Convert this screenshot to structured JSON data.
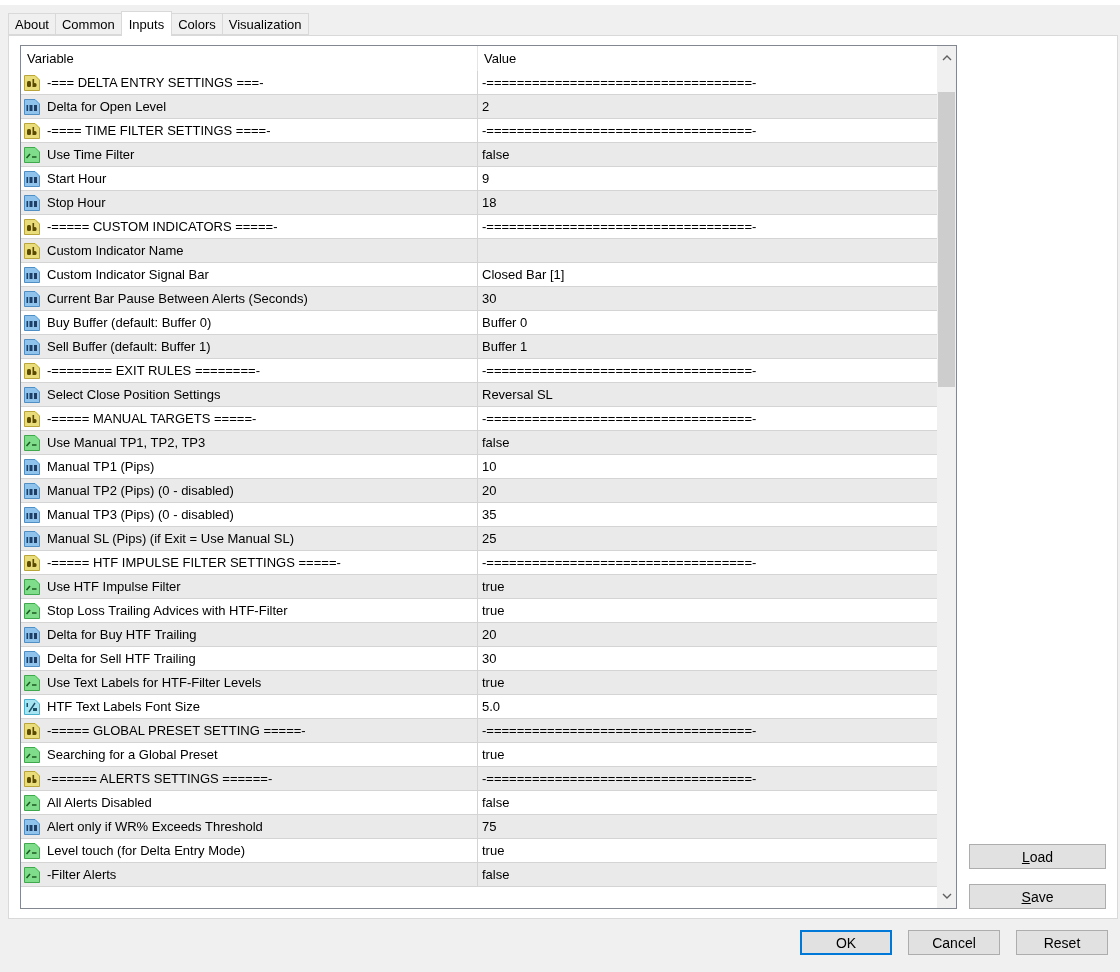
{
  "tabs": [
    {
      "label": "About",
      "selected": false
    },
    {
      "label": "Common",
      "selected": false
    },
    {
      "label": "Inputs",
      "selected": true
    },
    {
      "label": "Colors",
      "selected": false
    },
    {
      "label": "Visualization",
      "selected": false
    }
  ],
  "table": {
    "columns": [
      "Variable",
      "Value"
    ],
    "rows": [
      {
        "kind": "string",
        "variable": "-=== DELTA ENTRY SETTINGS ===-",
        "value": "-===================================-"
      },
      {
        "kind": "int",
        "variable": "Delta for Open Level",
        "value": "2"
      },
      {
        "kind": "string",
        "variable": "-==== TIME FILTER SETTINGS ====-",
        "value": "-===================================-"
      },
      {
        "kind": "bool",
        "variable": "Use Time Filter",
        "value": "false"
      },
      {
        "kind": "int",
        "variable": "Start Hour",
        "value": "9"
      },
      {
        "kind": "int",
        "variable": "Stop Hour",
        "value": "18"
      },
      {
        "kind": "string",
        "variable": "-=====  CUSTOM INDICATORS  =====-",
        "value": "-===================================-"
      },
      {
        "kind": "string",
        "variable": "Custom Indicator Name"
      },
      {
        "kind": "int",
        "variable": "Custom Indicator Signal Bar",
        "value": "Closed Bar [1]"
      },
      {
        "kind": "int",
        "variable": "Current Bar Pause Between Alerts (Seconds)",
        "value": "30"
      },
      {
        "kind": "int",
        "variable": "Buy Buffer (default: Buffer 0)",
        "value": "Buffer 0"
      },
      {
        "kind": "int",
        "variable": "Sell Buffer (default: Buffer 1)",
        "value": "Buffer 1"
      },
      {
        "kind": "string",
        "variable": "-========  EXIT  RULES  ========-",
        "value": "-===================================-"
      },
      {
        "kind": "int",
        "variable": "Select Close Position Settings",
        "value": "Reversal SL"
      },
      {
        "kind": "string",
        "variable": "-=====  MANUAL TARGETS  =====-",
        "value": "-===================================-"
      },
      {
        "kind": "bool",
        "variable": "Use Manual TP1, TP2, TP3",
        "value": "false"
      },
      {
        "kind": "int",
        "variable": "Manual TP1 (Pips)",
        "value": "10"
      },
      {
        "kind": "int",
        "variable": "Manual TP2 (Pips) (0 - disabled)",
        "value": "20"
      },
      {
        "kind": "int",
        "variable": "Manual TP3 (Pips) (0 - disabled)",
        "value": "35"
      },
      {
        "kind": "int",
        "variable": "Manual SL (Pips) (if Exit = Use Manual SL)",
        "value": "25"
      },
      {
        "kind": "string",
        "variable": "-=====  HTF IMPULSE FILTER SETTINGS  =====-",
        "value": "-===================================-"
      },
      {
        "kind": "bool",
        "variable": "Use HTF Impulse Filter",
        "value": "true"
      },
      {
        "kind": "bool",
        "variable": "Stop Loss Trailing Advices with HTF-Filter",
        "value": "true"
      },
      {
        "kind": "int",
        "variable": "Delta for Buy HTF Trailing",
        "value": "20"
      },
      {
        "kind": "int",
        "variable": "Delta for Sell HTF Trailing",
        "value": "30"
      },
      {
        "kind": "bool",
        "variable": "Use Text Labels for HTF-Filter Levels",
        "value": "true"
      },
      {
        "kind": "double",
        "variable": "HTF Text Labels Font Size",
        "value": "5.0"
      },
      {
        "kind": "string",
        "variable": "-=====  GLOBAL PRESET SETTING  =====-",
        "value": "-===================================-"
      },
      {
        "kind": "bool",
        "variable": "Searching for a Global Preset",
        "value": "true"
      },
      {
        "kind": "string",
        "variable": "-======  ALERTS SETTINGS  ======-",
        "value": "-===================================-"
      },
      {
        "kind": "bool",
        "variable": "All Alerts Disabled",
        "value": "false"
      },
      {
        "kind": "int",
        "variable": "Alert only if WR% Exceeds Threshold",
        "value": "75"
      },
      {
        "kind": "bool",
        "variable": "Level touch (for Delta Entry Mode)",
        "value": "true"
      },
      {
        "kind": "bool",
        "variable": "-Filter Alerts",
        "value": "false"
      }
    ]
  },
  "side_buttons": [
    "Load",
    "Save"
  ],
  "buttons": [
    {
      "label": "OK",
      "default": true
    },
    {
      "label": "Cancel",
      "default": false
    },
    {
      "label": "Reset",
      "default": false
    }
  ]
}
